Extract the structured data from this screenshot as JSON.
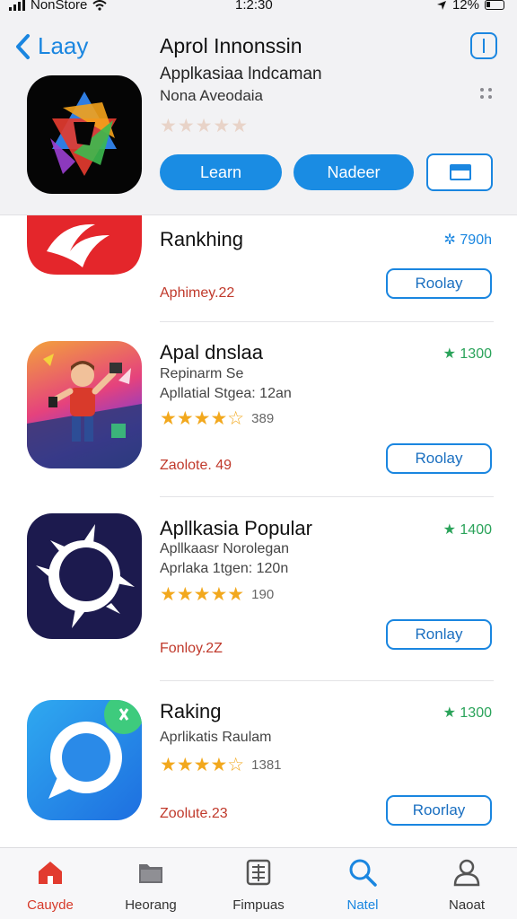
{
  "status_bar": {
    "carrier": "NonStore",
    "time": "1:2:30",
    "battery": "12%"
  },
  "header": {
    "back_label": "Laay",
    "title": "Aprol Innonssin",
    "subtitle": "Applkasiaa lndcaman",
    "developer": "Nona Aveodaia",
    "rating_stars": "★★★★★",
    "buttons": {
      "learn": "Learn",
      "nadeer": "Nadeer"
    }
  },
  "apps": [
    {
      "name": "Rankhing",
      "meta1": "",
      "meta2": "",
      "stars": "",
      "review_count": "",
      "badge": "✲ 790h",
      "badge_color": "blue",
      "price": "Aphimey.22",
      "button": "Roolay"
    },
    {
      "name": "Apal dnslaa",
      "meta1": "Repinarm Se",
      "meta2": "Apllatial Stgea: 12an",
      "stars": "★★★★☆",
      "review_count": "389",
      "badge": "★ 1300",
      "badge_color": "green",
      "price": "Zaolote. 49",
      "button": "Roolay"
    },
    {
      "name": "Apllkasia Popular",
      "meta1": "Apllkaasr Norolegan",
      "meta2": "Aprlaka 1tgen: 120n",
      "stars": "★★★★★",
      "review_count": "190",
      "badge": "★ 1400",
      "badge_color": "green",
      "price": "Fonloy.2Z",
      "button": "Ronlay"
    },
    {
      "name": "Raking",
      "meta1": "Aprlikatis Raulam",
      "meta2": "",
      "stars": "★★★★☆",
      "review_count": "1381",
      "badge": "★ 1300",
      "badge_color": "green",
      "price": "Zoolute.23",
      "button": "Roorlay"
    }
  ],
  "tabs": [
    {
      "label": "Cauyde",
      "icon": "home-icon",
      "state": "active"
    },
    {
      "label": "Heorang",
      "icon": "folder-icon",
      "state": "normal"
    },
    {
      "label": "Fimpuas",
      "icon": "grid-doc-icon",
      "state": "normal"
    },
    {
      "label": "Natel",
      "icon": "search-icon",
      "state": "blue"
    },
    {
      "label": "Naoat",
      "icon": "person-icon",
      "state": "normal"
    }
  ],
  "colors": {
    "accent": "#1a8ce3",
    "badge_green": "#2aa35a",
    "price_red": "#c0392b",
    "star": "#f2a81d",
    "active_tab": "#d63a2a"
  }
}
